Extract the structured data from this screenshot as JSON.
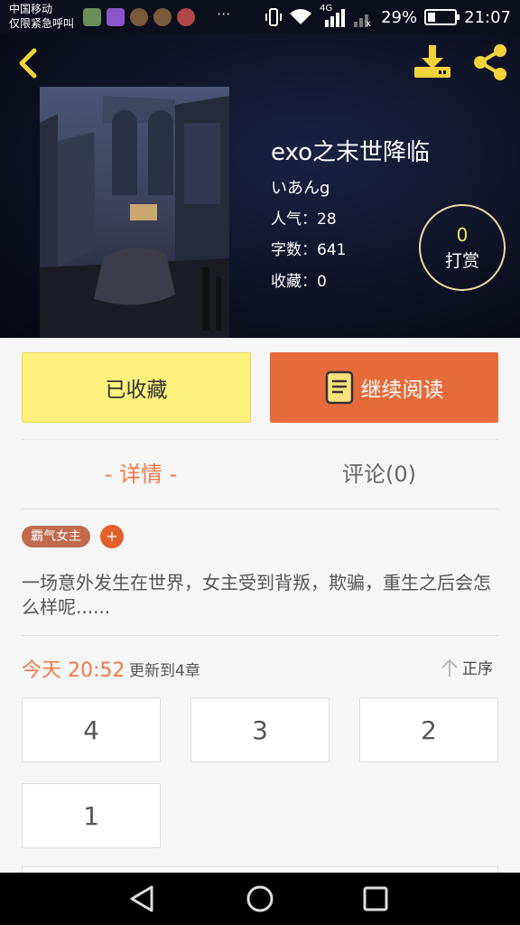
{
  "status_bar": {
    "carrier_line1": "中国移动",
    "carrier_line2": "仅限紧急呼叫",
    "more": "···",
    "network": "4G",
    "battery_text": "29%",
    "battery_level": 0.29,
    "time": "21:07"
  },
  "book": {
    "title": "exo之末世降临",
    "author": "いあんg",
    "popularity_label": "人气：",
    "popularity": "28",
    "word_count_label": "字数：",
    "word_count": "641",
    "favorites_label": "收藏：",
    "favorites": "0"
  },
  "tip": {
    "count": "0",
    "label": "打赏"
  },
  "actions": {
    "favorite_label": "已收藏",
    "read_label": "继续阅读"
  },
  "tabs": {
    "detail": "- 详情 -",
    "comments": "评论(0)"
  },
  "tags": {
    "items": [
      "霸气女主"
    ],
    "add": "+"
  },
  "summary": "一场意外发生在世界，女主受到背叛，欺骗，重生之后会怎么样呢......",
  "update": {
    "date": "今天 20:52",
    "text": "更新到4章",
    "sort_label": "正序"
  },
  "chapters": [
    "4",
    "3",
    "2",
    "1"
  ],
  "colors": {
    "accent": "#ef7a4a",
    "read_button": "#e66b3a",
    "favorite_button": "#fbf17c",
    "tag": "#c16a4e",
    "header_bg": "#0d1122"
  },
  "icons": {
    "back": "chevron-left-icon",
    "download": "download-icon",
    "share": "share-icon",
    "book": "book-icon",
    "sort": "arrow-up-icon",
    "nav_back": "triangle-back-icon",
    "nav_home": "circle-home-icon",
    "nav_recent": "square-recent-icon"
  }
}
